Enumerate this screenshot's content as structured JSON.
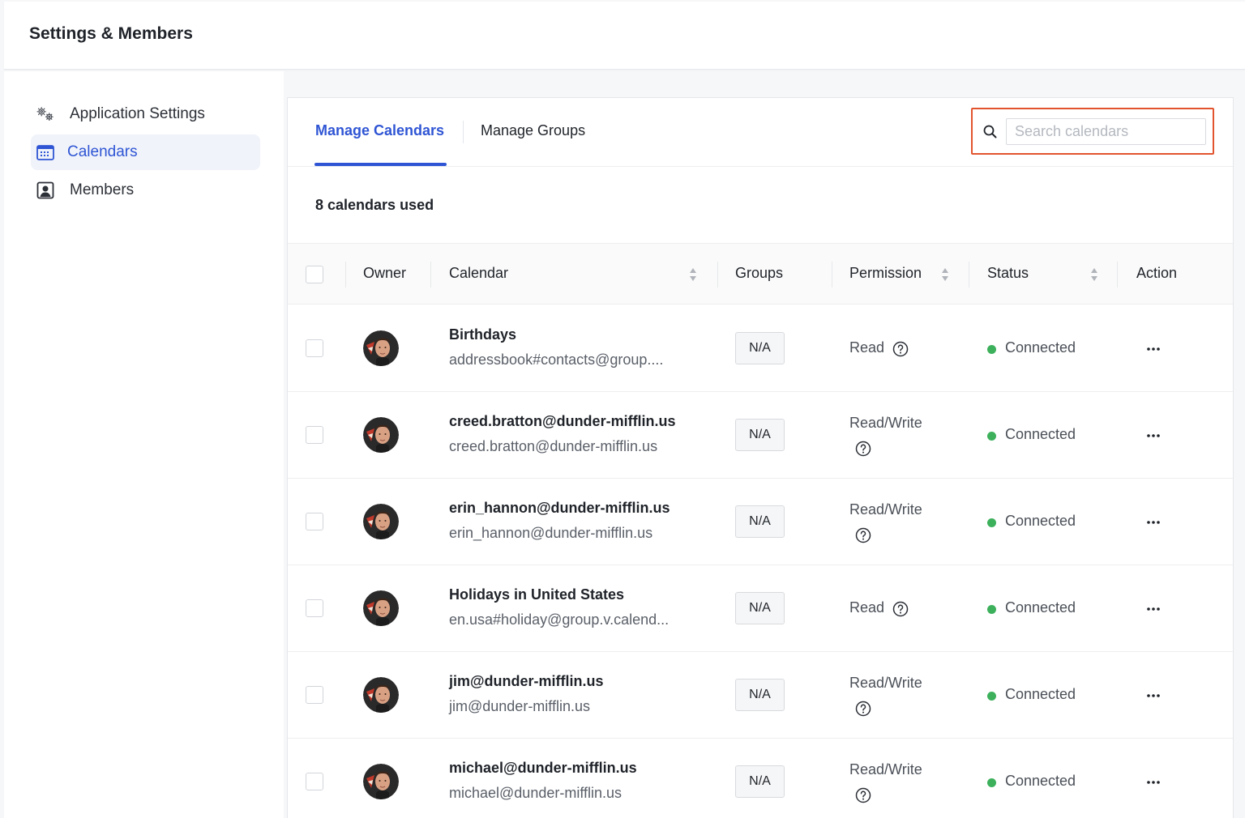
{
  "header": {
    "title": "Settings & Members"
  },
  "sidebar": {
    "items": [
      {
        "label": "Application Settings",
        "icon": "gears-icon",
        "active": false
      },
      {
        "label": "Calendars",
        "icon": "calendar-icon",
        "active": true
      },
      {
        "label": "Members",
        "icon": "member-icon",
        "active": false
      }
    ]
  },
  "tabs": [
    {
      "label": "Manage Calendars",
      "active": true
    },
    {
      "label": "Manage Groups",
      "active": false
    }
  ],
  "search": {
    "placeholder": "Search calendars",
    "value": ""
  },
  "summary": {
    "count_text": "8 calendars used"
  },
  "table": {
    "columns": {
      "owner": "Owner",
      "calendar": "Calendar",
      "groups": "Groups",
      "permission": "Permission",
      "status": "Status",
      "action": "Action"
    },
    "rows": [
      {
        "name": "Birthdays",
        "sub": "addressbook#contacts@group....",
        "groups": "N/A",
        "permission": "Read",
        "status": "Connected"
      },
      {
        "name": "creed.bratton@dunder-mifflin.us",
        "sub": "creed.bratton@dunder-mifflin.us",
        "groups": "N/A",
        "permission": "Read/Write",
        "status": "Connected"
      },
      {
        "name": "erin_hannon@dunder-mifflin.us",
        "sub": "erin_hannon@dunder-mifflin.us",
        "groups": "N/A",
        "permission": "Read/Write",
        "status": "Connected"
      },
      {
        "name": "Holidays in United States",
        "sub": "en.usa#holiday@group.v.calend...",
        "groups": "N/A",
        "permission": "Read",
        "status": "Connected"
      },
      {
        "name": "jim@dunder-mifflin.us",
        "sub": "jim@dunder-mifflin.us",
        "groups": "N/A",
        "permission": "Read/Write",
        "status": "Connected"
      },
      {
        "name": "michael@dunder-mifflin.us",
        "sub": "michael@dunder-mifflin.us",
        "groups": "N/A",
        "permission": "Read/Write",
        "status": "Connected"
      }
    ]
  },
  "colors": {
    "accent": "#2f55d4",
    "connected": "#3db05c",
    "highlight": "#e2542e"
  }
}
